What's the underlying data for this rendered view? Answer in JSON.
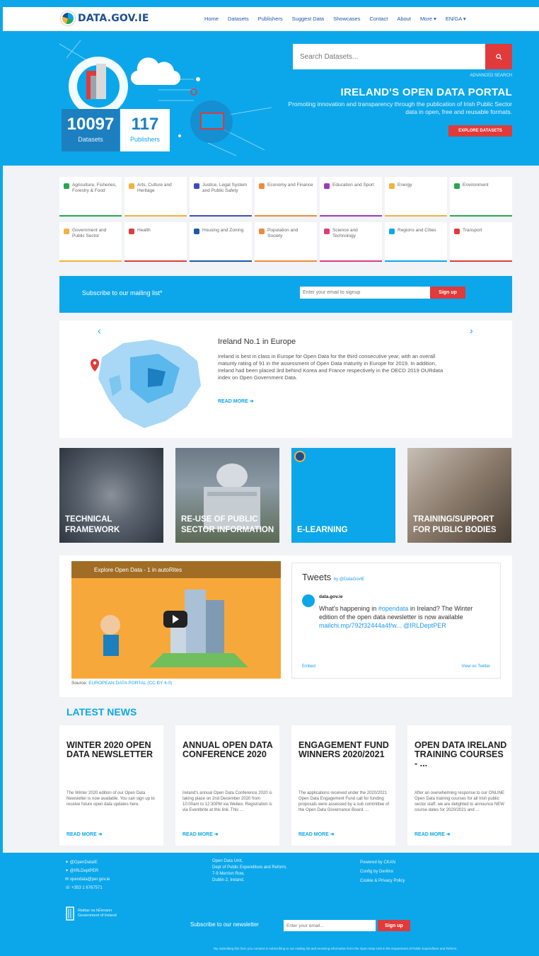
{
  "header": {
    "logo_text": "DATA.GOV.IE",
    "nav": [
      "Home",
      "Datasets",
      "Publishers",
      "Suggest Data",
      "Showcases",
      "Contact",
      "About",
      "More ▾",
      "EN/GA ▾"
    ]
  },
  "hero": {
    "search_placeholder": "Search Datasets...",
    "advanced": "ADVANCED SEARCH",
    "title": "IRELAND'S OPEN DATA PORTAL",
    "subtitle": "Promoting innovation and transparency through the publication of Irish Public Sector data in open, free and reusable formats.",
    "explore": "EXPLORE DATASETS",
    "datasets_count": "10097",
    "datasets_label": "Datasets",
    "publishers_count": "117",
    "publishers_label": "Publishers"
  },
  "categories": [
    {
      "label": "Agriculture, Fisheries, Forestry & Food",
      "color": "#2aa653"
    },
    {
      "label": "Arts, Culture and Heritage",
      "color": "#f2b33d"
    },
    {
      "label": "Justice, Legal System and Public Safety",
      "color": "#3f4bc0"
    },
    {
      "label": "Economy and Finance",
      "color": "#f08a3a"
    },
    {
      "label": "Education and Sport",
      "color": "#9a3ac0"
    },
    {
      "label": "Energy",
      "color": "#f2b33d"
    },
    {
      "label": "Environment",
      "color": "#2aa653"
    },
    {
      "label": "Government and Public Sector",
      "color": "#f2b33d"
    },
    {
      "label": "Health",
      "color": "#e03a3a"
    },
    {
      "label": "Housing and Zoning",
      "color": "#1d5aa0"
    },
    {
      "label": "Population and Society",
      "color": "#f08a3a"
    },
    {
      "label": "Science and Technology",
      "color": "#e03a7a"
    },
    {
      "label": "Regions and Cities",
      "color": "#0ca7ea"
    },
    {
      "label": "Transport",
      "color": "#e03a3a"
    }
  ],
  "subscribe": {
    "text": "Subscribe to our mailing list*",
    "placeholder": "Enter your email to signup",
    "button": "Sign up"
  },
  "feature": {
    "title": "Ireland No.1 in Europe",
    "body": "Ireland is best in class in Europe for Open Data for the third consecutive year, with an overall maturity rating of 91 in the assessment of Open Data maturity in Europe for 2019. In addition, Ireland had been placed 3rd behind Korea and France respectively in the OECD 2019 OURdata index on Open Government Data.",
    "more": "READ MORE ➜"
  },
  "tiles": [
    {
      "label": "TECHNICAL FRAMEWORK"
    },
    {
      "label": "RE-USE OF PUBLIC SECTOR INFORMATION"
    },
    {
      "label": "E-LEARNING"
    },
    {
      "label": "TRAINING/SUPPORT FOR PUBLIC BODIES"
    }
  ],
  "video": {
    "title": "Explore Open Data - 1 in autoRites",
    "source_prefix": "Source:",
    "source_link": "EUROPEAN DATA PORTAL (CC BY 4.0)"
  },
  "tweets": {
    "header": "Tweets",
    "by": "by @DataGovIE",
    "name": "data.gov.ie",
    "text_a": "What's happening in ",
    "text_tag": "#opendata",
    "text_b": " in Ireland? The Winter edition of the open data newsletter is now available ",
    "text_link": "mailchi.mp/792f32444a4f/w... @IRLDeptPER",
    "embed": "Embed",
    "view": "View on Twitter"
  },
  "news": {
    "title": "LATEST NEWS",
    "items": [
      {
        "title": "WINTER 2020 OPEN DATA NEWSLETTER",
        "body": "The Winter 2020 edition of our Open Data Newsletter is now available. You can sign up to receive future open data updates here.",
        "more": "READ MORE ➜"
      },
      {
        "title": "ANNUAL OPEN DATA CONFERENCE 2020",
        "body": "Ireland's annual Open Data Conference 2020 is taking place on 2nd December 2020 from 10:00am to 12:30PM via Webex. Registration is via Eventbrite at this link. This ...",
        "more": "READ MORE ➜"
      },
      {
        "title": "ENGAGEMENT FUND WINNERS 2020/2021",
        "body": "The applications received under the 2020/2021 Open Data Engagement Fund call for funding proposals were assessed by a sub committee of the Open Data Governance Board. ...",
        "more": "READ MORE ➜"
      },
      {
        "title": "OPEN DATA IRELAND TRAINING COURSES - ...",
        "body": "After an overwhelming response to our ONLINE Open Data training courses for all Irish public sector staff, we are delighted to announce NEW course dates for 2020/2021 and ...",
        "more": "READ MORE ➜"
      }
    ]
  },
  "footer": {
    "social": [
      "@OpenDataIE",
      "@IRLDeptPER",
      "opendata@per.gov.ie",
      "+353 1 6767571"
    ],
    "address": [
      "Open Data Unit,",
      "Dept of Public Expenditure and Reform,",
      "7-9 Merrion Row,",
      "Dublin 2, Ireland."
    ],
    "powered": [
      "Powered by CKAN",
      "Config by Derilinx",
      "Cookie & Privacy Policy"
    ],
    "harp_label": "Rialtas na hÉireann Government of Ireland",
    "newsletter": "Subscribe to our newsletter",
    "newsletter_placeholder": "Enter your email...",
    "newsletter_button": "Sign up",
    "legal": "*By submitting this form you consent to subscribing to our mailing list and receiving information from the Open Data Unit in the Department of Public Expenditure and Reform."
  }
}
